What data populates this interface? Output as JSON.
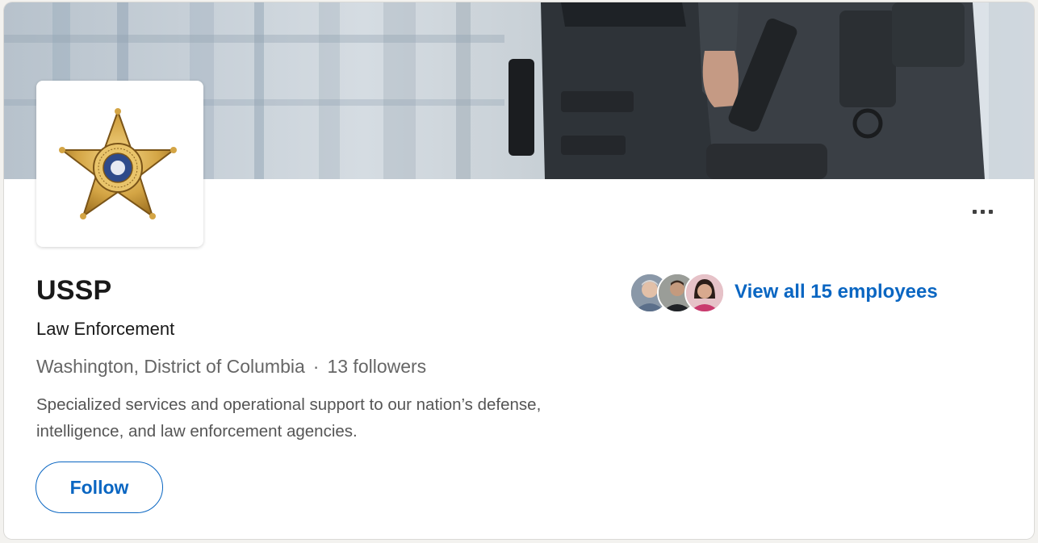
{
  "company": {
    "name": "USSP",
    "industry": "Law Enforcement",
    "location": "Washington, District of Columbia",
    "separator": "·",
    "followers": "13 followers",
    "description": "Specialized services and operational support to our nation’s defense, intelligence, and law enforcement agencies.",
    "logo_icon": "police-star-badge-icon"
  },
  "actions": {
    "follow_label": "Follow",
    "more_icon": "ellipsis-icon"
  },
  "employees": {
    "link_label": "View all 15 employees",
    "avatar_count": 3
  },
  "colors": {
    "accent": "#0a66c2",
    "text_primary": "#191919",
    "text_secondary": "#666666"
  }
}
